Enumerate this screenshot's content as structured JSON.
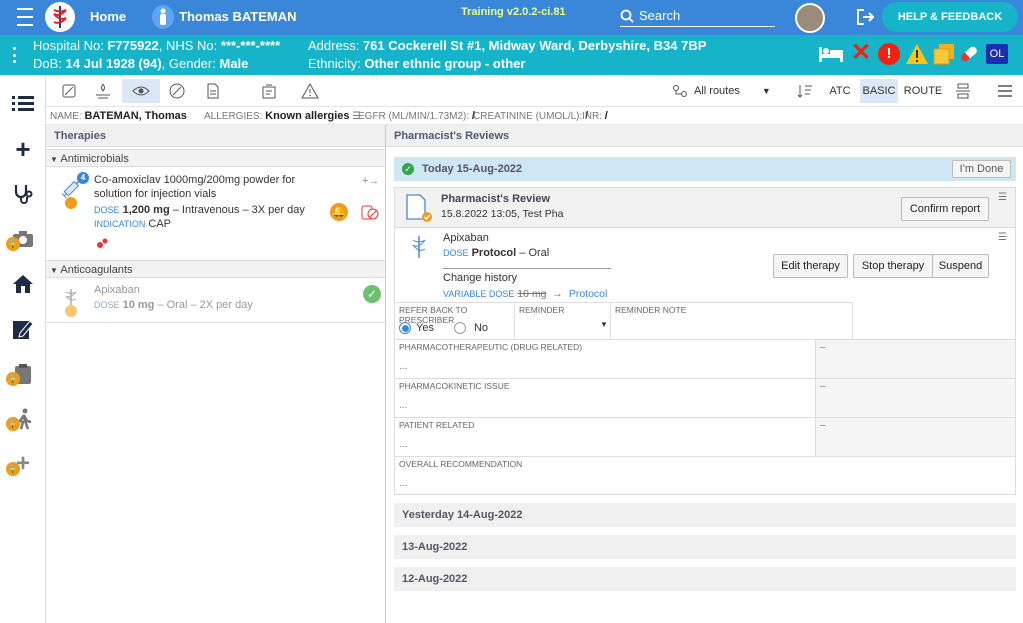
{
  "topbar": {
    "home_label": "Home",
    "patient_name": "Thomas BATEMAN",
    "training": "Training v2.0.2-ci.81",
    "search_placeholder": "Search",
    "help_label": "HELP & FEEDBACK"
  },
  "patient": {
    "hospital_label": "Hospital No:",
    "hospital_no": "F775922",
    "nhs_label": ", NHS No:",
    "nhs_no": "***-***-****",
    "dob_label": "DoB:",
    "dob": "14 Jul 1928 (94)",
    "gender_label": ", Gender:",
    "gender": "Male",
    "address_label": "Address:",
    "address": "761 Cockerell St #1, Midway Ward, Derbyshire, B34 7BP",
    "ethnicity_label": "Ethnicity:",
    "ethnicity": "Other ethnic group - other",
    "ol_badge": "OL"
  },
  "toolbar": {
    "routes": "All routes",
    "atc": "ATC",
    "basic": "BASIC",
    "route": "ROUTE"
  },
  "info": {
    "name_label": "NAME:",
    "name": "BATEMAN, Thomas",
    "allergies_label": "ALLERGIES:",
    "allergies": "Known allergies",
    "egfr_label": "EGFR (ML/MIN/1.73M2):",
    "egfr": "/",
    "creat_label": "CREATININE (UMOL/L):",
    "creat": "/",
    "inr_label": "INR:",
    "inr": "/"
  },
  "therapies": {
    "title": "Therapies",
    "groups": [
      "Antimicrobials",
      "Anticoagulants"
    ],
    "drug1": {
      "badge": "4",
      "name_line1": "Co-amoxiclav 1000mg/200mg powder for",
      "name_line2": "solution for injection vials",
      "dose_label": "DOSE",
      "dose": "1,200 mg",
      "dose_rest": "– Intravenous – 3X per day",
      "indication_label": "INDICATION",
      "indication": "CAP"
    },
    "drug2": {
      "name": "Apixaban",
      "dose_label": "DOSE",
      "dose": "10 mg",
      "dose_rest": "– Oral – 2X per day"
    }
  },
  "reviews": {
    "title": "Pharmacist's Reviews",
    "today": "Today 15-Aug-2022",
    "im_done": "I'm Done",
    "review_title": "Pharmacist's Review",
    "review_meta": "15.8.2022 13:05, Test Pha",
    "confirm": "Confirm report",
    "drug": "Apixaban",
    "dose_label": "DOSE",
    "dose": "Protocol",
    "dose_rest": "– Oral",
    "change_history": "Change history",
    "variable_dose_label": "VARIABLE DOSE",
    "old_dose": "10 mg",
    "new_dose": "Protocol",
    "edit_therapy": "Edit therapy",
    "stop_therapy": "Stop therapy",
    "suspend": "Suspend",
    "refer_back": "REFER BACK TO PRESCRIBER",
    "yes": "Yes",
    "no": "No",
    "reminder": "REMINDER",
    "reminder_note": "REMINDER NOTE",
    "pharmacotherapeutic": "PHARMACOTHERAPEUTIC (DRUG RELATED)",
    "pharmacokinetic": "PHARMACOKINETIC ISSUE",
    "patient_related": "PATIENT RELATED",
    "overall": "OVERALL RECOMMENDATION",
    "ellipsis": "...",
    "dash": "–",
    "days": [
      "Yesterday 14-Aug-2022",
      "13-Aug-2022",
      "12-Aug-2022"
    ]
  }
}
